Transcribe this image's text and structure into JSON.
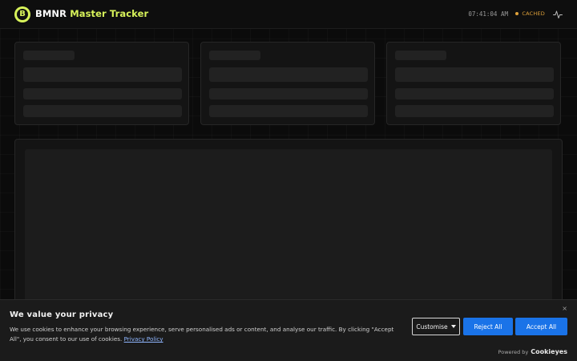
{
  "header": {
    "logo_letter": "B",
    "ticker": "BMNR",
    "title": "Master Tracker",
    "clock": "07:41:04 AM",
    "status": "CACHED",
    "status_color": "#e0a23a",
    "accent_color": "#d7f25a",
    "pulse_icon": "activity-pulse-icon"
  },
  "cookie": {
    "title": "We value your privacy",
    "text": "We use cookies to enhance your browsing experience, serve personalised ads or content, and analyse our traffic. By clicking \"Accept All\", you consent to our use of cookies.",
    "policy_link": "Privacy Policy",
    "customise_label": "Customise",
    "reject_label": "Reject All",
    "accept_label": "Accept All",
    "close_icon": "×",
    "powered_by": "Powered by",
    "powered_brand": "Cookieyes",
    "button_color": "#1a73e8"
  }
}
